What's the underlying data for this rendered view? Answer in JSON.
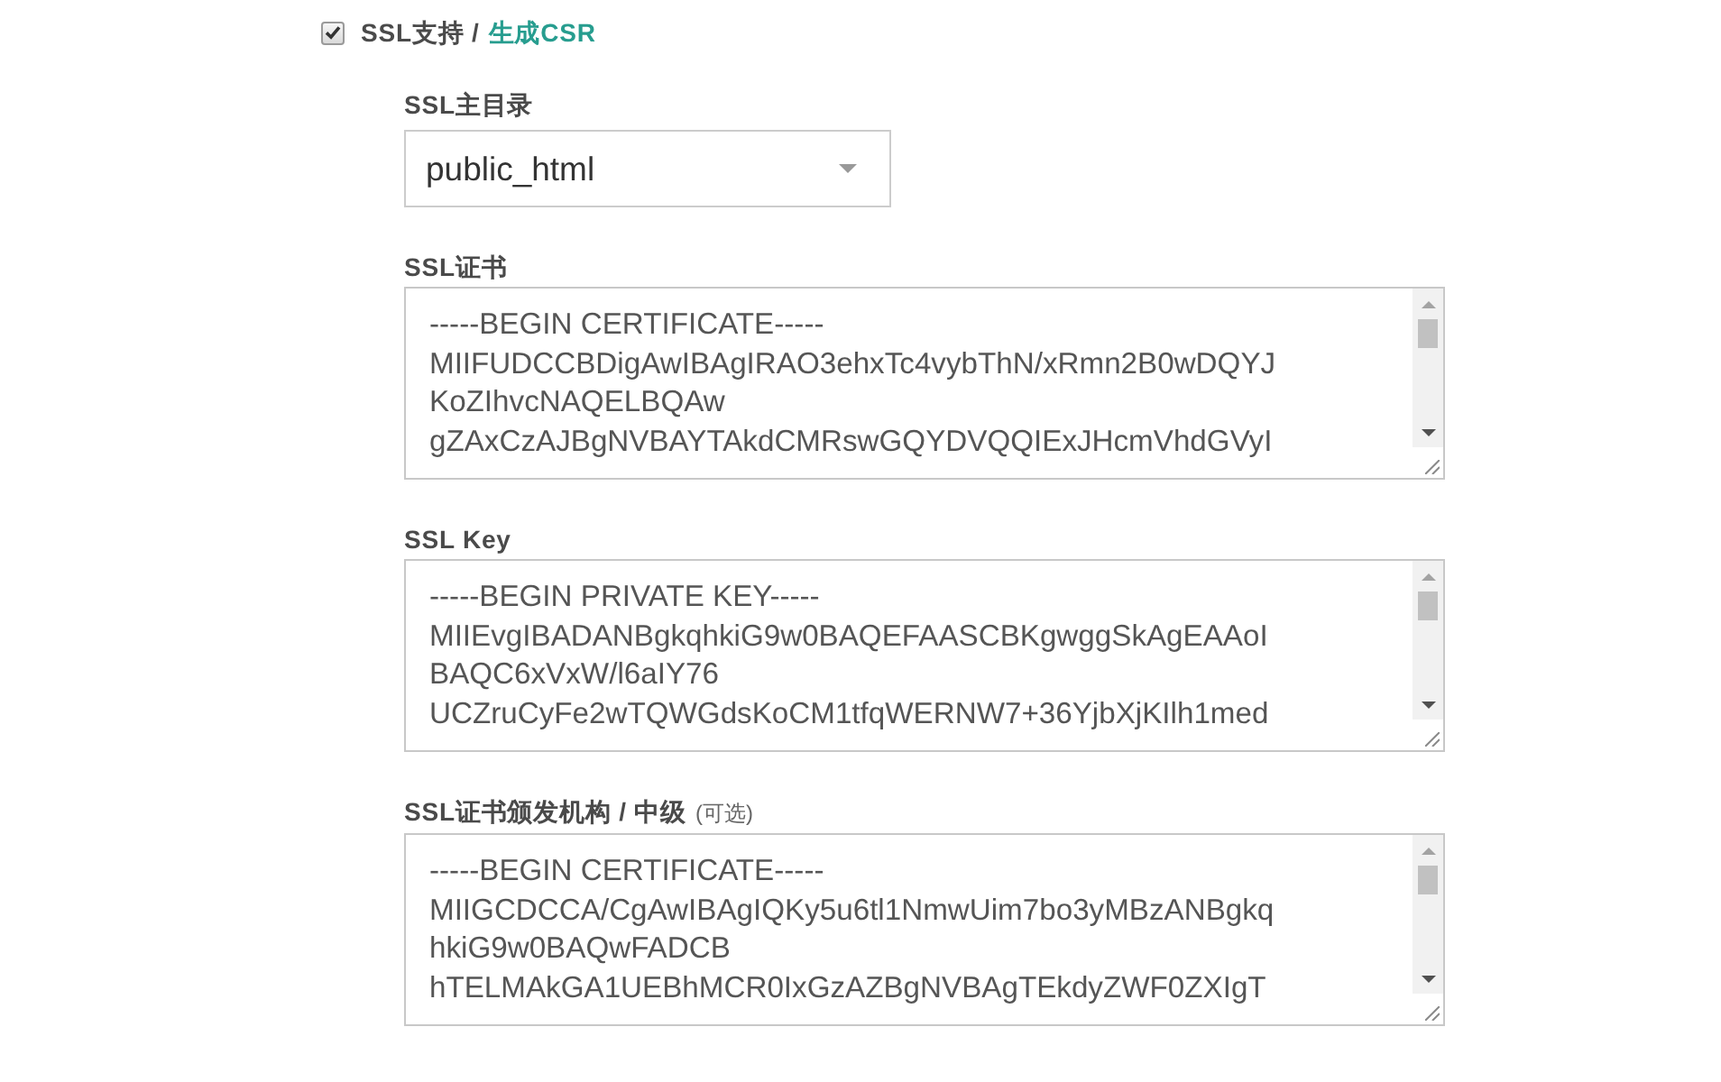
{
  "ssl_support": {
    "checked": true,
    "label": "SSL支持 /",
    "link": "生成CSR"
  },
  "ssl_directory": {
    "label": "SSL主目录",
    "value": "public_html"
  },
  "fields": [
    {
      "label": "SSL证书",
      "value": "-----BEGIN CERTIFICATE-----\nMIIFUDCCBDigAwIBAgIRAO3ehxTc4vybThN/xRmn2B0wDQYJ\nKoZIhvcNAQELBQAw\ngZAxCzAJBgNVBAYTAkdCMRswGQYDVQQIExJHcmVhdGVyI"
    },
    {
      "label": "SSL Key",
      "value": "-----BEGIN PRIVATE KEY-----\nMIIEvgIBADANBgkqhkiG9w0BAQEFAASCBKgwggSkAgEAAoI\nBAQC6xVxW/l6aIY76\nUCZruCyFe2wTQWGdsKoCM1tfqWERNW7+36YjbXjKIlh1med"
    },
    {
      "label": "SSL证书颁发机构 / 中级",
      "note": "(可选)",
      "value": "-----BEGIN CERTIFICATE-----\nMIIGCDCCA/CgAwIBAgIQKy5u6tl1NmwUim7bo3yMBzANBgkq\nhkiG9w0BAQwFADCB\nhTELMAkGA1UEBhMCR0IxGzAZBgNVBAgTEkdyZWF0ZXIgT"
    }
  ]
}
